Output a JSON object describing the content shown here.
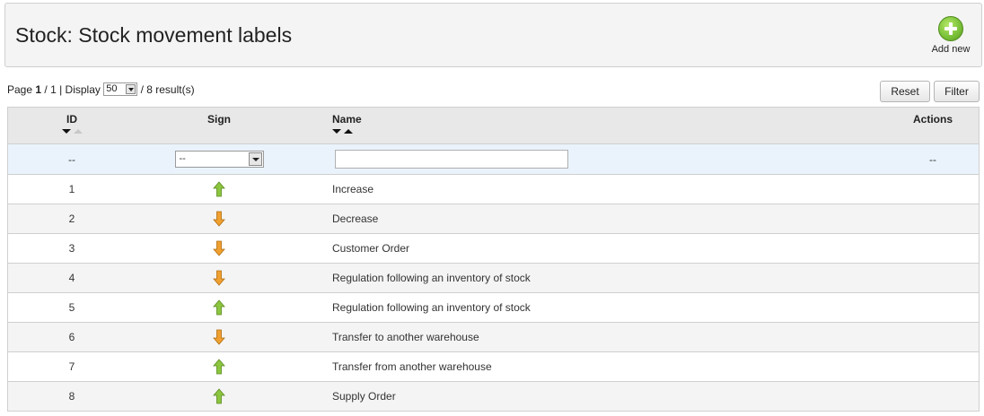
{
  "header": {
    "title": "Stock: Stock movement labels",
    "add_new_label": "Add new"
  },
  "pagination": {
    "page_label": "Page",
    "current_page": "1",
    "total_pages": "/ 1",
    "display_label": "| Display",
    "per_page": "50",
    "results": "/ 8 result(s)"
  },
  "buttons": {
    "reset": "Reset",
    "filter": "Filter"
  },
  "columns": {
    "id": "ID",
    "sign": "Sign",
    "name": "Name",
    "actions": "Actions"
  },
  "filters": {
    "id": "--",
    "sign": "--",
    "name": "",
    "actions": "--"
  },
  "colors": {
    "increase": "#8cc63f",
    "decrease": "#f0a030"
  },
  "rows": [
    {
      "id": "1",
      "sign": "up-arrow-icon",
      "name": "Increase"
    },
    {
      "id": "2",
      "sign": "down-arrow-icon",
      "name": "Decrease"
    },
    {
      "id": "3",
      "sign": "down-arrow-icon",
      "name": "Customer Order"
    },
    {
      "id": "4",
      "sign": "down-arrow-icon",
      "name": "Regulation following an inventory of stock"
    },
    {
      "id": "5",
      "sign": "up-arrow-icon",
      "name": "Regulation following an inventory of stock"
    },
    {
      "id": "6",
      "sign": "down-arrow-icon",
      "name": "Transfer to another warehouse"
    },
    {
      "id": "7",
      "sign": "up-arrow-icon",
      "name": "Transfer from another warehouse"
    },
    {
      "id": "8",
      "sign": "up-arrow-icon",
      "name": "Supply Order"
    }
  ]
}
